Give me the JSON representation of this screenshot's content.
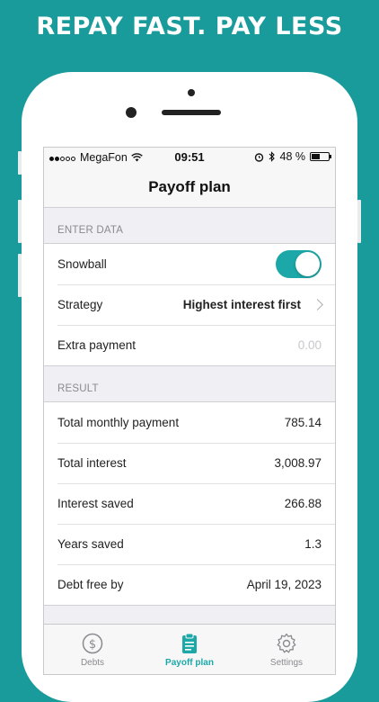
{
  "promo": {
    "headline": "REPAY FAST. PAY LESS"
  },
  "status_bar": {
    "carrier": "MegaFon",
    "time": "09:51",
    "battery": "48 %",
    "battery_level": 0.48,
    "signal_bars": 2
  },
  "navbar": {
    "title": "Payoff plan"
  },
  "enter_data": {
    "header": "ENTER DATA",
    "snowball_label": "Snowball",
    "snowball_on": true,
    "strategy_label": "Strategy",
    "strategy_value": "Highest interest first",
    "extra_payment_label": "Extra payment",
    "extra_payment_placeholder": "0.00"
  },
  "result": {
    "header": "RESULT",
    "rows": [
      {
        "label": "Total monthly payment",
        "value": "785.14"
      },
      {
        "label": "Total interest",
        "value": "3,008.97"
      },
      {
        "label": "Interest saved",
        "value": "266.88"
      },
      {
        "label": "Years saved",
        "value": "1.3"
      },
      {
        "label": "Debt free by",
        "value": "April 19, 2023"
      }
    ]
  },
  "tabbar": {
    "tabs": [
      {
        "label": "Debts",
        "icon": "dollar-circle-icon"
      },
      {
        "label": "Payoff plan",
        "icon": "clipboard-icon"
      },
      {
        "label": "Settings",
        "icon": "gear-icon"
      }
    ]
  },
  "colors": {
    "background": "#1a9b9b",
    "accent": "#1ca8a8"
  }
}
